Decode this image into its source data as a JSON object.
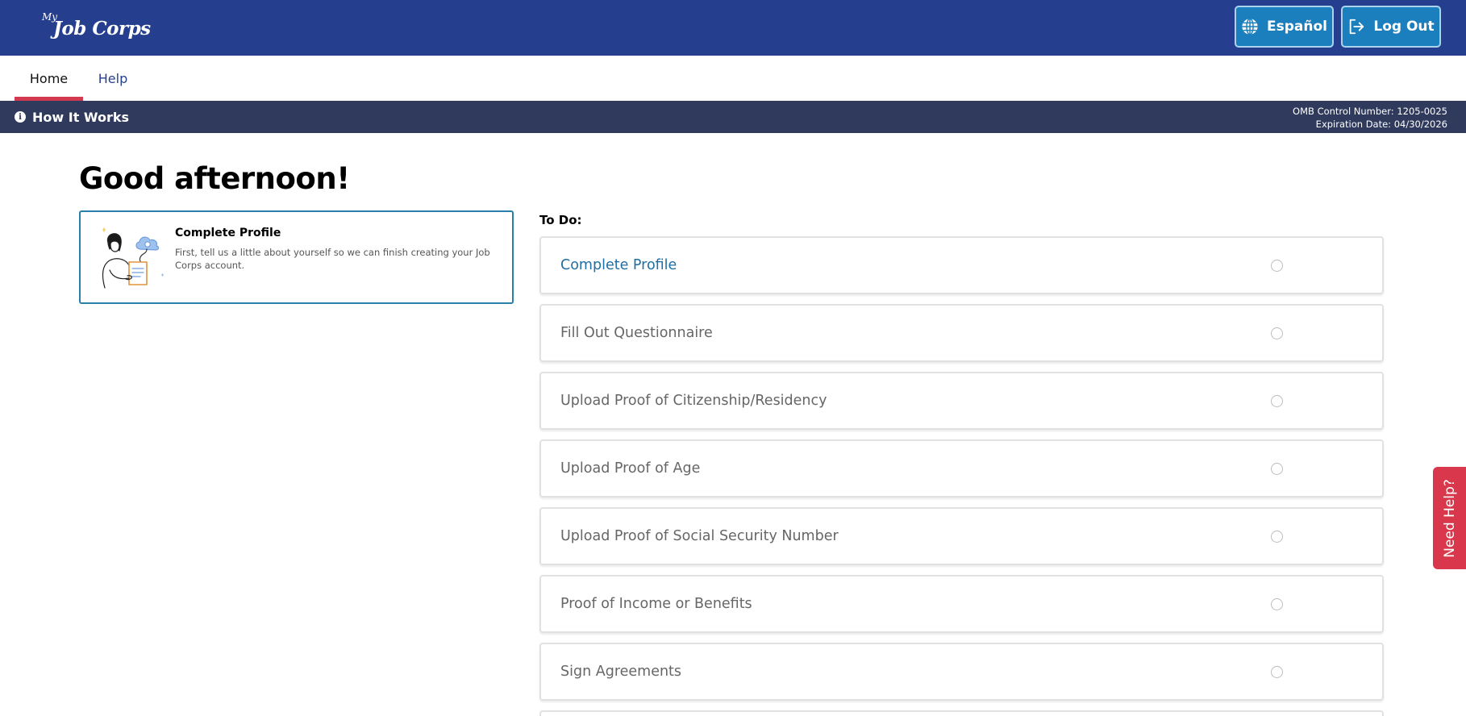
{
  "header": {
    "logo_small": "My",
    "logo_main": "Job Corps",
    "language_button": "Español",
    "logout_button": "Log Out"
  },
  "nav": {
    "tabs": [
      {
        "label": "Home",
        "active": true
      },
      {
        "label": "Help",
        "active": false
      }
    ]
  },
  "info_bar": {
    "how_it_works": "How It Works",
    "omb_control": "OMB Control Number: 1205-0025",
    "expiration": "Expiration Date: 04/30/2026"
  },
  "main": {
    "greeting": "Good afternoon!",
    "profile_card": {
      "title": "Complete Profile",
      "description": "First, tell us a little about yourself so we can finish creating your Job Corps account."
    },
    "todo": {
      "label": "To Do:",
      "items": [
        {
          "label": "Complete Profile",
          "active": true,
          "done": false
        },
        {
          "label": "Fill Out Questionnaire",
          "active": false,
          "done": false
        },
        {
          "label": "Upload Proof of Citizenship/Residency",
          "active": false,
          "done": false
        },
        {
          "label": "Upload Proof of Age",
          "active": false,
          "done": false
        },
        {
          "label": "Upload Proof of Social Security Number",
          "active": false,
          "done": false
        },
        {
          "label": "Proof of Income or Benefits",
          "active": false,
          "done": false
        },
        {
          "label": "Sign Agreements",
          "active": false,
          "done": false
        }
      ]
    }
  },
  "need_help": "Need Help?",
  "colors": {
    "header_bg": "#253f8e",
    "button_bg": "#1c7fbd",
    "info_bar_bg": "#2f3a5c",
    "accent_red": "#d9374b",
    "active_link": "#1f6fa3"
  },
  "icons": {
    "language": "globe-icon",
    "logout": "logout-icon",
    "info": "info-icon",
    "todo_status": "empty-circle-icon"
  }
}
